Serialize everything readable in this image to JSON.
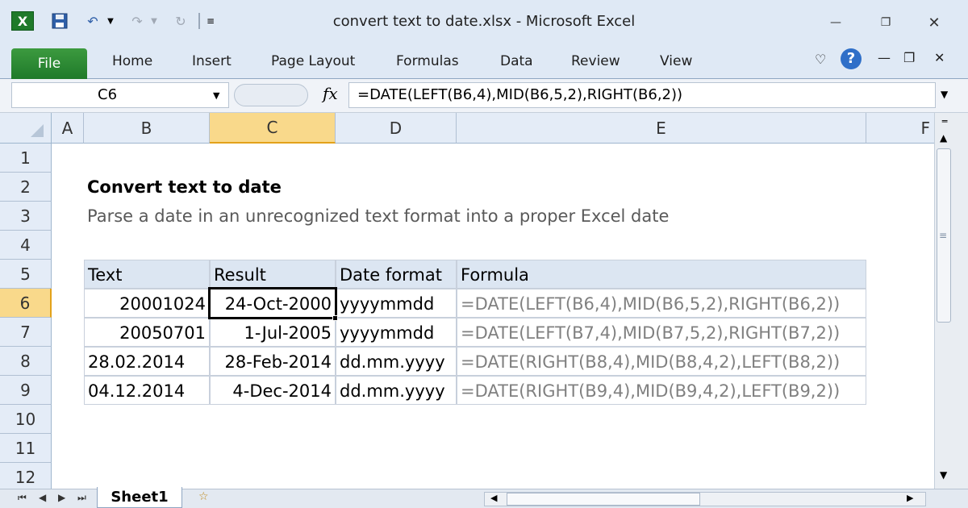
{
  "window": {
    "title": "convert text to date.xlsx  -  Microsoft Excel"
  },
  "quick_access": {
    "icons": [
      "excel-logo-icon",
      "save-icon",
      "undo-icon",
      "redo-icon",
      "refresh-icon",
      "customize-qat-icon"
    ]
  },
  "ribbon": {
    "tabs": [
      "File",
      "Home",
      "Insert",
      "Page Layout",
      "Formulas",
      "Data",
      "Review",
      "View"
    ],
    "file_color": "#2a8a34"
  },
  "formula_bar": {
    "name_box": "C6",
    "fx_label": "fx",
    "formula": "=DATE(LEFT(B6,4),MID(B6,5,2),RIGHT(B6,2))"
  },
  "columns": [
    "A",
    "B",
    "C",
    "D",
    "E",
    "F"
  ],
  "rows": [
    "1",
    "2",
    "3",
    "4",
    "5",
    "6",
    "7",
    "8",
    "9",
    "10",
    "11",
    "12"
  ],
  "selected": {
    "column": "C",
    "row": "6"
  },
  "sheet": {
    "title": "Convert text to date",
    "subtitle": "Parse a date in an unrecognized text format into a proper Excel date",
    "table": {
      "headers": [
        "Text",
        "Result",
        "Date format",
        "Formula"
      ],
      "rows": [
        [
          "20001024",
          "24-Oct-2000",
          "yyyymmdd",
          "=DATE(LEFT(B6,4),MID(B6,5,2),RIGHT(B6,2))"
        ],
        [
          "20050701",
          "1-Jul-2005",
          "yyyymmdd",
          "=DATE(LEFT(B7,4),MID(B7,5,2),RIGHT(B7,2))"
        ],
        [
          "28.02.2014",
          "28-Feb-2014",
          "dd.mm.yyyy",
          "=DATE(RIGHT(B8,4),MID(B8,4,2),LEFT(B8,2))"
        ],
        [
          "04.12.2014",
          "4-Dec-2014",
          "dd.mm.yyyy",
          "=DATE(RIGHT(B9,4),MID(B9,4,2),LEFT(B9,2))"
        ]
      ]
    }
  },
  "sheet_tabs": [
    "Sheet1"
  ],
  "colors": {
    "header_fill": "#dce6f2",
    "selected_header": "#f9d98b",
    "formula_text": "#808080"
  }
}
